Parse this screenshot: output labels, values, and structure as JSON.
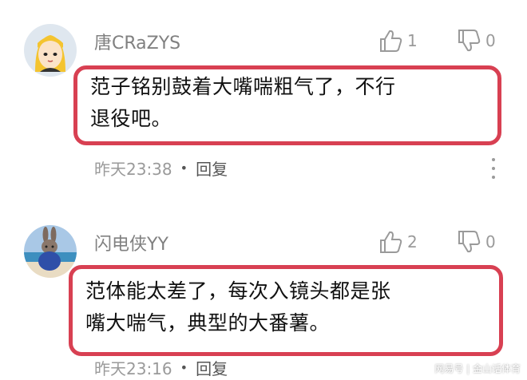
{
  "comments": [
    {
      "username": "唐CRaZYS",
      "avatar_icon": "cartoon-girl-avatar",
      "likes": "1",
      "dislikes": "0",
      "text_line1": "范子铭别鼓着大嘴喘粗气了，不行",
      "text_line2": "退役吧。",
      "time": "昨天23:38",
      "reply_label": "回复"
    },
    {
      "username": "闪电侠YY",
      "avatar_icon": "bunny-beach-avatar",
      "likes": "2",
      "dislikes": "0",
      "text_line1": "范体能太差了，每次入镜头都是张",
      "text_line2": "嘴大喘气，典型的大番薯。",
      "time": "昨天23:16",
      "reply_label": "回复"
    }
  ],
  "dot_separator": "•",
  "watermark": "网易号 | 金山话体育",
  "colors": {
    "highlight_border": "#d84052",
    "meta_text": "#9a9a9a"
  }
}
